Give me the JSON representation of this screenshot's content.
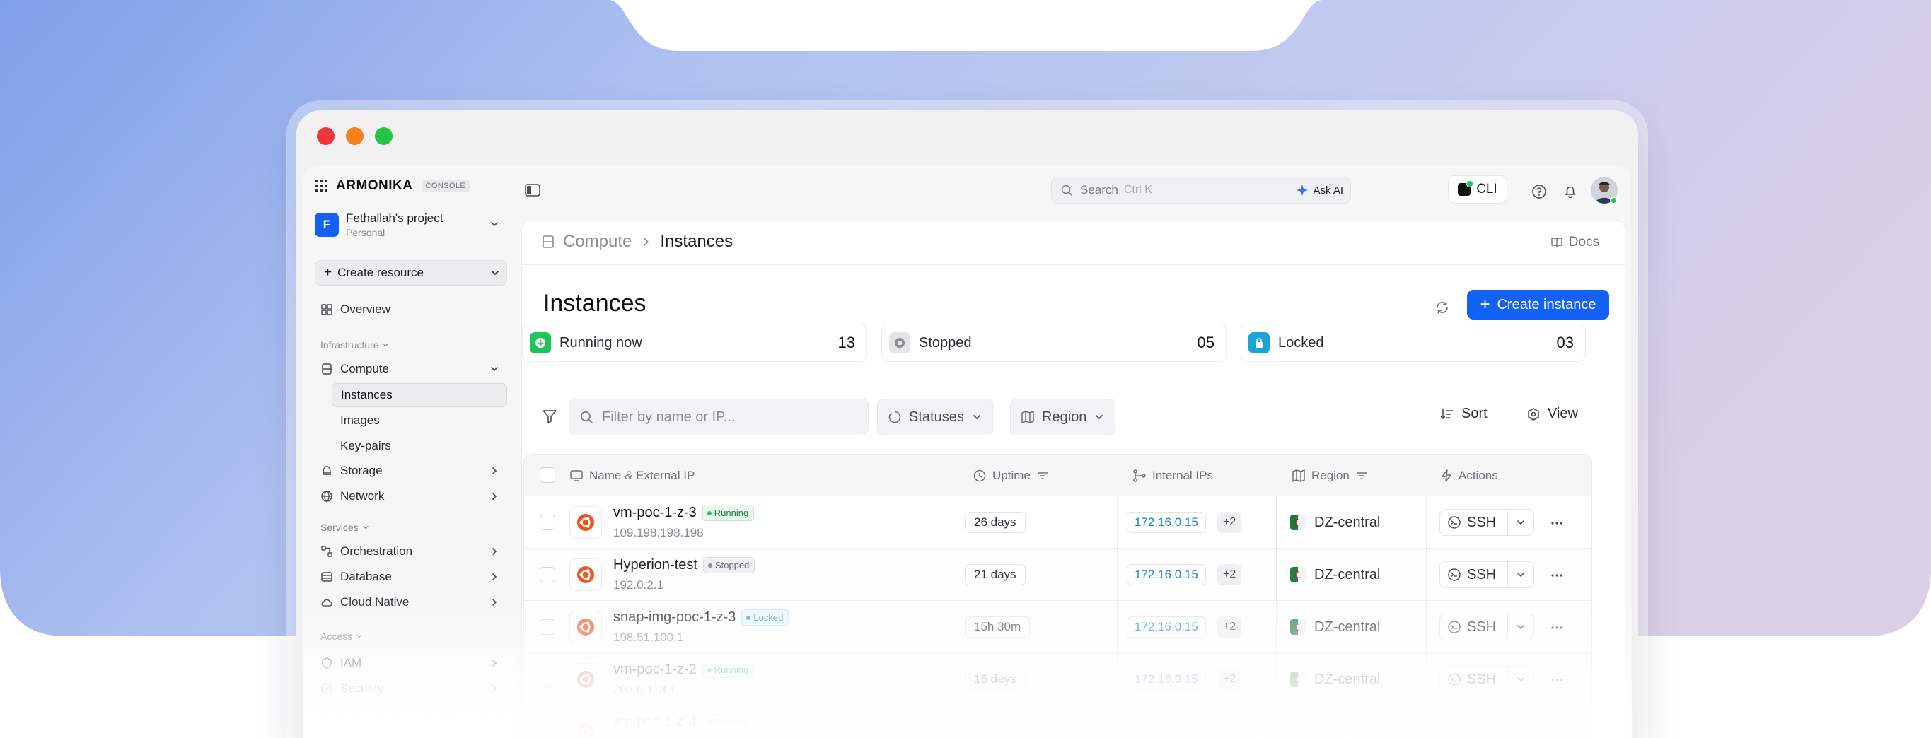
{
  "colors": {
    "accent": "#1462f5",
    "running": "#1fc45a",
    "locked": "#1ba6d6",
    "ubuntu": "#e9541f"
  },
  "brand": {
    "logo": "ARMONIKA",
    "badge": "CONSOLE"
  },
  "project": {
    "initial": "F",
    "name": "Fethallah's project",
    "type": "Personal"
  },
  "sidebar": {
    "create_resource": "Create resource",
    "overview": "Overview",
    "groups": {
      "infrastructure": "Infrastructure",
      "services": "Services",
      "access": "Access"
    },
    "compute": "Compute",
    "compute_sub": [
      "Instances",
      "Images",
      "Key-pairs"
    ],
    "storage": "Storage",
    "network": "Network",
    "orchestration": "Orchestration",
    "database": "Database",
    "cloud_native": "Cloud Native",
    "iam": "IAM",
    "security": "Security"
  },
  "topbar": {
    "search_label": "Search",
    "search_shortcut": "Ctrl K",
    "ask_ai": "Ask AI",
    "cli": "CLI"
  },
  "breadcrumb": {
    "parent": "Compute",
    "current": "Instances"
  },
  "docs": "Docs",
  "page": {
    "title": "Instances",
    "create_button": "Create instance"
  },
  "stats": [
    {
      "label": "Running now",
      "value": "13"
    },
    {
      "label": "Stopped",
      "value": "05"
    },
    {
      "label": "Locked",
      "value": "03"
    }
  ],
  "filters": {
    "placeholder": "Filter by name or IP...",
    "statuses": "Statuses",
    "region": "Region",
    "sort": "Sort",
    "view": "View"
  },
  "table": {
    "headers": {
      "name": "Name & External IP",
      "uptime": "Uptime",
      "internal_ips": "Internal IPs",
      "region": "Region",
      "actions": "Actions"
    },
    "ssh_label": "SSH",
    "rows": [
      {
        "name": "vm-poc-1-z-3",
        "status": "Running",
        "ip": "109.198.198.198",
        "uptime": "26 days",
        "internal_ip": "172.16.0.15",
        "extra_ips": "+2",
        "region": "DZ-central"
      },
      {
        "name": "Hyperion-test",
        "status": "Stopped",
        "ip": "192.0.2.1",
        "uptime": "21 days",
        "internal_ip": "172.16.0.15",
        "extra_ips": "+2",
        "region": "DZ-central"
      },
      {
        "name": "snap-img-poc-1-z-3",
        "status": "Locked",
        "ip": "198.51.100.1",
        "uptime": "15h 30m",
        "internal_ip": "172.16.0.15",
        "extra_ips": "+2",
        "region": "DZ-central"
      },
      {
        "name": "vm-poc-1-z-2",
        "status": "Running",
        "ip": "203.0.113.1",
        "uptime": "16 days",
        "internal_ip": "172.16.0.15",
        "extra_ips": "+2",
        "region": "DZ-central"
      },
      {
        "name": "vm-poc-1-z-4",
        "status": "Running",
        "ip": "",
        "uptime": "",
        "internal_ip": "",
        "extra_ips": "",
        "region": ""
      }
    ]
  }
}
